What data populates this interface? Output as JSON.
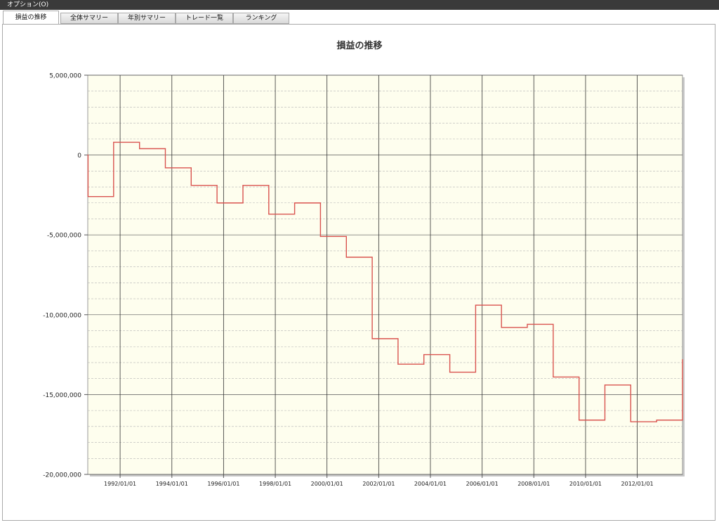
{
  "menu": {
    "options_label": "オプション(O)"
  },
  "tabs": [
    {
      "label": "損益の推移",
      "active": true
    },
    {
      "label": "全体サマリー",
      "active": false
    },
    {
      "label": "年別サマリー",
      "active": false
    },
    {
      "label": "トレード一覧",
      "active": false
    },
    {
      "label": "ランキング",
      "active": false
    }
  ],
  "colors": {
    "plot_background": "#fefeee",
    "series_line": "#d9534f",
    "menubar": "#3a3a3a"
  },
  "chart_data": {
    "type": "line",
    "title": "損益の推移",
    "xlabel": "",
    "ylabel": "",
    "xlim": [
      "1990/10/01",
      "2013/10/01"
    ],
    "ylim": [
      -20000000,
      5000000
    ],
    "y_ticks": [
      {
        "value": 5000000,
        "label": "5,000,000"
      },
      {
        "value": 0,
        "label": "0"
      },
      {
        "value": -5000000,
        "label": "-5,000,000"
      },
      {
        "value": -10000000,
        "label": "-10,000,000"
      },
      {
        "value": -15000000,
        "label": "-15,000,000"
      },
      {
        "value": -20000000,
        "label": "-20,000,000"
      }
    ],
    "x_ticks": [
      "1992/01/01",
      "1994/01/01",
      "1996/01/01",
      "1998/01/01",
      "2000/01/01",
      "2002/01/01",
      "2004/01/01",
      "2006/01/01",
      "2008/01/01",
      "2010/01/01",
      "2012/01/01"
    ],
    "grid": true,
    "legend": "none",
    "series": [
      {
        "step": true,
        "points": [
          {
            "x": "1990/10/01",
            "y": 0
          },
          {
            "x": "1990/10/05",
            "y": -2600000
          },
          {
            "x": "1991/10/01",
            "y": 800000
          },
          {
            "x": "1992/10/01",
            "y": 400000
          },
          {
            "x": "1993/10/01",
            "y": -800000
          },
          {
            "x": "1994/10/01",
            "y": -1900000
          },
          {
            "x": "1995/10/01",
            "y": -3000000
          },
          {
            "x": "1996/10/01",
            "y": -1900000
          },
          {
            "x": "1997/10/01",
            "y": -3700000
          },
          {
            "x": "1998/10/01",
            "y": -3000000
          },
          {
            "x": "1999/10/01",
            "y": -5100000
          },
          {
            "x": "2000/10/01",
            "y": -6400000
          },
          {
            "x": "2001/10/01",
            "y": -11500000
          },
          {
            "x": "2002/10/01",
            "y": -13100000
          },
          {
            "x": "2003/10/01",
            "y": -12500000
          },
          {
            "x": "2004/10/01",
            "y": -13600000
          },
          {
            "x": "2005/10/01",
            "y": -9400000
          },
          {
            "x": "2006/10/01",
            "y": -10800000
          },
          {
            "x": "2007/10/01",
            "y": -10600000
          },
          {
            "x": "2008/10/01",
            "y": -13900000
          },
          {
            "x": "2009/10/01",
            "y": -16600000
          },
          {
            "x": "2010/10/01",
            "y": -14400000
          },
          {
            "x": "2011/10/01",
            "y": -16700000
          },
          {
            "x": "2012/10/01",
            "y": -16600000
          },
          {
            "x": "2013/10/01",
            "y": -12800000
          }
        ]
      }
    ]
  }
}
